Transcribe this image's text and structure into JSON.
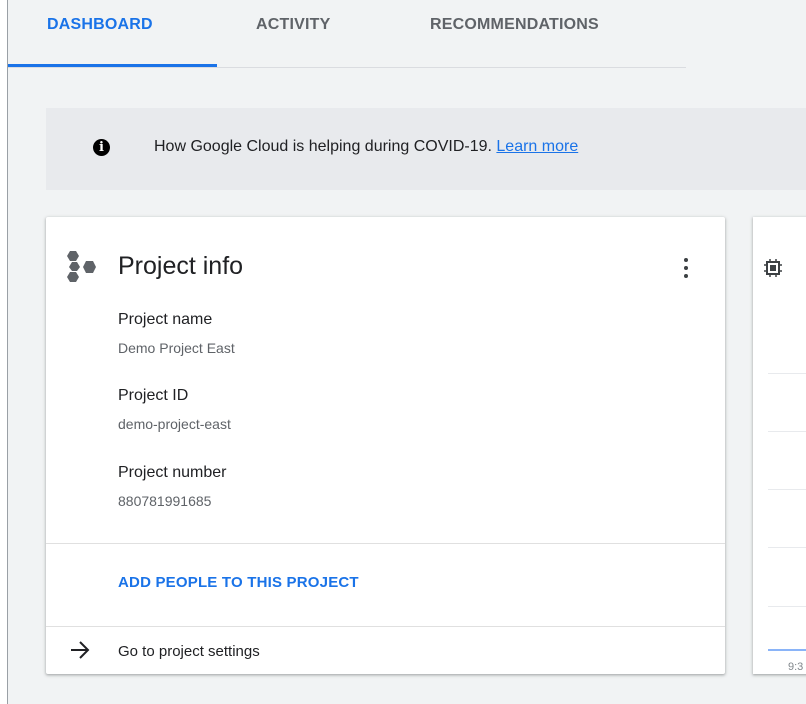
{
  "tabs": [
    {
      "label": "DASHBOARD",
      "active": true
    },
    {
      "label": "ACTIVITY",
      "active": false
    },
    {
      "label": "RECOMMENDATIONS",
      "active": false
    }
  ],
  "banner": {
    "text": "How Google Cloud is helping during COVID-19. ",
    "link": "Learn more",
    "icon": "info-icon"
  },
  "project_card": {
    "title": "Project info",
    "icon": "project-hexagons-icon",
    "fields": [
      {
        "label": "Project name",
        "value": "Demo Project East"
      },
      {
        "label": "Project ID",
        "value": "demo-project-east"
      },
      {
        "label": "Project number",
        "value": "880781991685"
      }
    ],
    "add_people_label": "ADD PEOPLE TO THIS PROJECT",
    "settings_label": "Go to project settings"
  },
  "side_card": {
    "icon": "chip-icon",
    "axis_tick": "9:3"
  },
  "colors": {
    "accent": "#1a73e8",
    "background": "#f1f3f4",
    "banner": "#e8eaed"
  }
}
